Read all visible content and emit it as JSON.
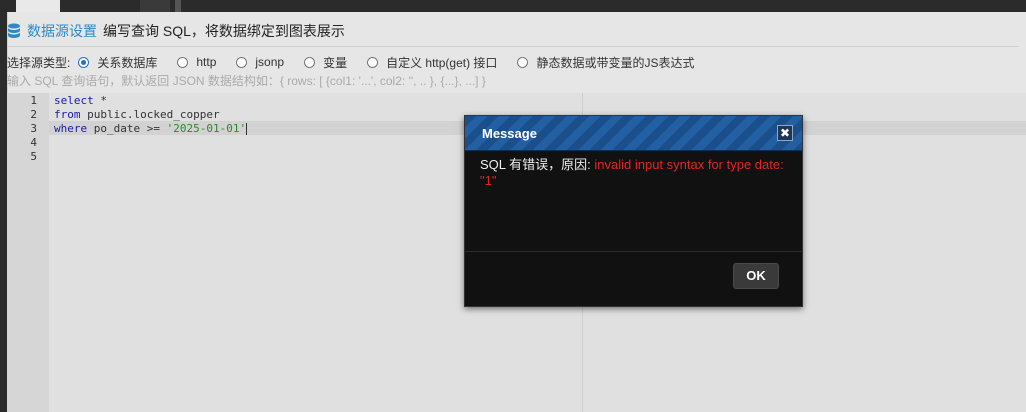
{
  "header": {
    "title": "数据源设置",
    "description": "编写查询 SQL，将数据绑定到图表展示"
  },
  "source_type": {
    "label": "选择源类型:",
    "options": [
      {
        "label": "关系数据库",
        "selected": true
      },
      {
        "label": "http",
        "selected": false
      },
      {
        "label": "jsonp",
        "selected": false
      },
      {
        "label": "变量",
        "selected": false
      },
      {
        "label": "自定义 http(get) 接口",
        "selected": false
      },
      {
        "label": "静态数据或带变量的JS表达式",
        "selected": false
      }
    ]
  },
  "hint": "输入 SQL 查询语句，默认返回 JSON 数据结构如：{ rows: [ {col1: '...', col2: '', .. }, {...}, ...] }",
  "editor": {
    "line_numbers": [
      "1",
      "2",
      "3",
      "4",
      "5"
    ],
    "line1_kw": "select",
    "line1_rest": " *",
    "line2_kw": "from",
    "line2_rest": " public.locked_copper",
    "line3_kw": "where",
    "line3_mid": " po_date >= ",
    "line3_str": "'2025-01-01'"
  },
  "modal": {
    "title": "Message",
    "close_glyph": "✖",
    "message_prefix": "SQL 有错误，原因: ",
    "error_text": "invalid input syntax for type date: \"1\"",
    "ok_label": "OK"
  },
  "colors": {
    "accent": "#2d8ac7",
    "error": "#e0271f",
    "modal_header": "#1a4f8c"
  }
}
